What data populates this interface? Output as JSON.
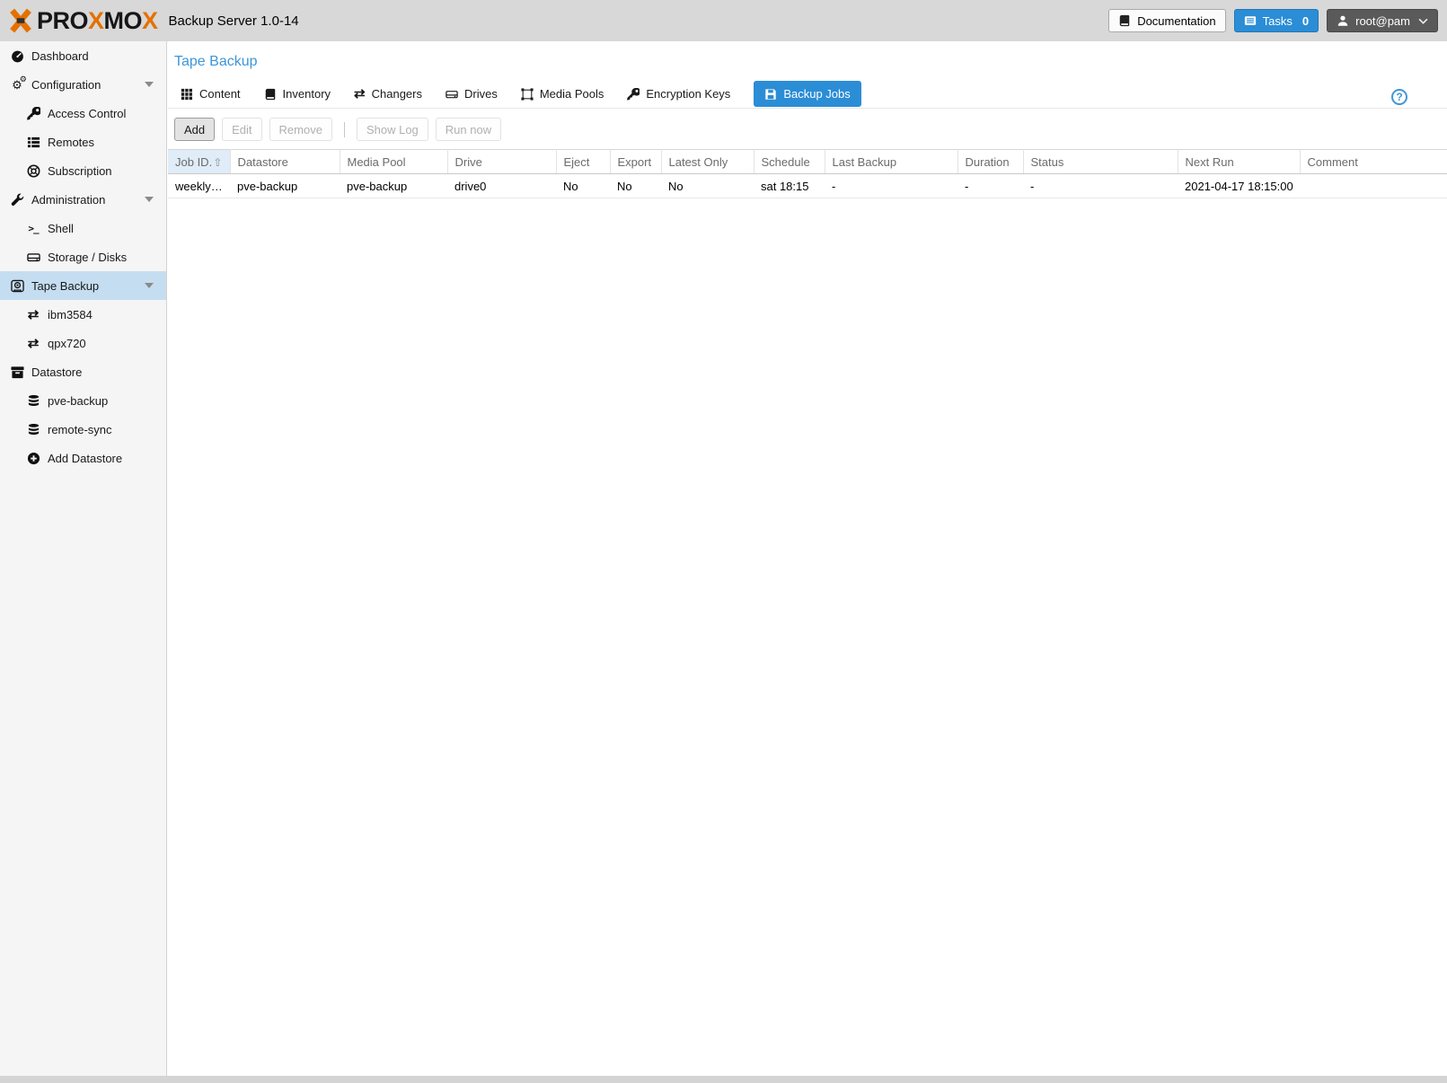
{
  "header": {
    "brand_p1": "PRO",
    "brand_x1": "X",
    "brand_p2": "MO",
    "brand_x2": "X",
    "subtitle": "Backup Server 1.0-14",
    "documentation_label": "Documentation",
    "tasks_label": "Tasks",
    "tasks_count": "0",
    "user_label": "root@pam"
  },
  "icons": {
    "gear": "⚙",
    "exchange": "⇄",
    "shell": ">_",
    "sort_asc": "⇧"
  },
  "sidebar": {
    "items": [
      {
        "label": "Dashboard",
        "icon": "tachometer",
        "level": 0,
        "selected": false,
        "expandable": false
      },
      {
        "label": "Configuration",
        "icon": "gears",
        "level": 0,
        "selected": false,
        "expandable": true
      },
      {
        "label": "Access Control",
        "icon": "key",
        "level": 1,
        "selected": false,
        "expandable": false
      },
      {
        "label": "Remotes",
        "icon": "list",
        "level": 1,
        "selected": false,
        "expandable": false
      },
      {
        "label": "Subscription",
        "icon": "life-ring",
        "level": 1,
        "selected": false,
        "expandable": false
      },
      {
        "label": "Administration",
        "icon": "wrench",
        "level": 0,
        "selected": false,
        "expandable": true
      },
      {
        "label": "Shell",
        "icon": "terminal",
        "level": 1,
        "selected": false,
        "expandable": false
      },
      {
        "label": "Storage / Disks",
        "icon": "hdd",
        "level": 1,
        "selected": false,
        "expandable": false
      },
      {
        "label": "Tape Backup",
        "icon": "tape",
        "level": 0,
        "selected": true,
        "expandable": true
      },
      {
        "label": "ibm3584",
        "icon": "exchange",
        "level": 1,
        "selected": false,
        "expandable": false
      },
      {
        "label": "qpx720",
        "icon": "exchange",
        "level": 1,
        "selected": false,
        "expandable": false
      },
      {
        "label": "Datastore",
        "icon": "archive",
        "level": 0,
        "selected": false,
        "expandable": false
      },
      {
        "label": "pve-backup",
        "icon": "database",
        "level": 1,
        "selected": false,
        "expandable": false
      },
      {
        "label": "remote-sync",
        "icon": "database",
        "level": 1,
        "selected": false,
        "expandable": false
      },
      {
        "label": "Add Datastore",
        "icon": "plus-circle",
        "level": 1,
        "selected": false,
        "expandable": false
      }
    ]
  },
  "main": {
    "title": "Tape Backup",
    "help_label": "?",
    "tabs": [
      {
        "label": "Content",
        "icon": "th",
        "active": false
      },
      {
        "label": "Inventory",
        "icon": "book",
        "active": false
      },
      {
        "label": "Changers",
        "icon": "exchange",
        "active": false
      },
      {
        "label": "Drives",
        "icon": "hdd",
        "active": false
      },
      {
        "label": "Media Pools",
        "icon": "object-group",
        "active": false
      },
      {
        "label": "Encryption Keys",
        "icon": "key",
        "active": false
      },
      {
        "label": "Backup Jobs",
        "icon": "floppy",
        "active": true
      }
    ],
    "toolbar": {
      "add_label": "Add",
      "edit_label": "Edit",
      "remove_label": "Remove",
      "show_log_label": "Show Log",
      "run_now_label": "Run now"
    },
    "table": {
      "columns": [
        "Job ID.",
        "Datastore",
        "Media Pool",
        "Drive",
        "Eject",
        "Export",
        "Latest Only",
        "Schedule",
        "Last Backup",
        "Duration",
        "Status",
        "Next Run",
        "Comment"
      ],
      "sorted_column": "Job ID.",
      "rows": [
        [
          "weekly…",
          "pve-backup",
          "pve-backup",
          "drive0",
          "No",
          "No",
          "No",
          "sat 18:15",
          "-",
          "-",
          "-",
          "2021-04-17 18:15:00",
          ""
        ]
      ]
    }
  },
  "colors": {
    "accent_blue": "#2b8dd6",
    "title_blue": "#3d96d8",
    "topbar_gray": "#d8d8d8",
    "sidebar_bg": "#f5f5f5",
    "selected_nav": "#c5ddf0",
    "sorted_header_bg": "#e0ecf7",
    "logo_orange": "#e57000",
    "user_button_gray": "#5a5a5a"
  }
}
